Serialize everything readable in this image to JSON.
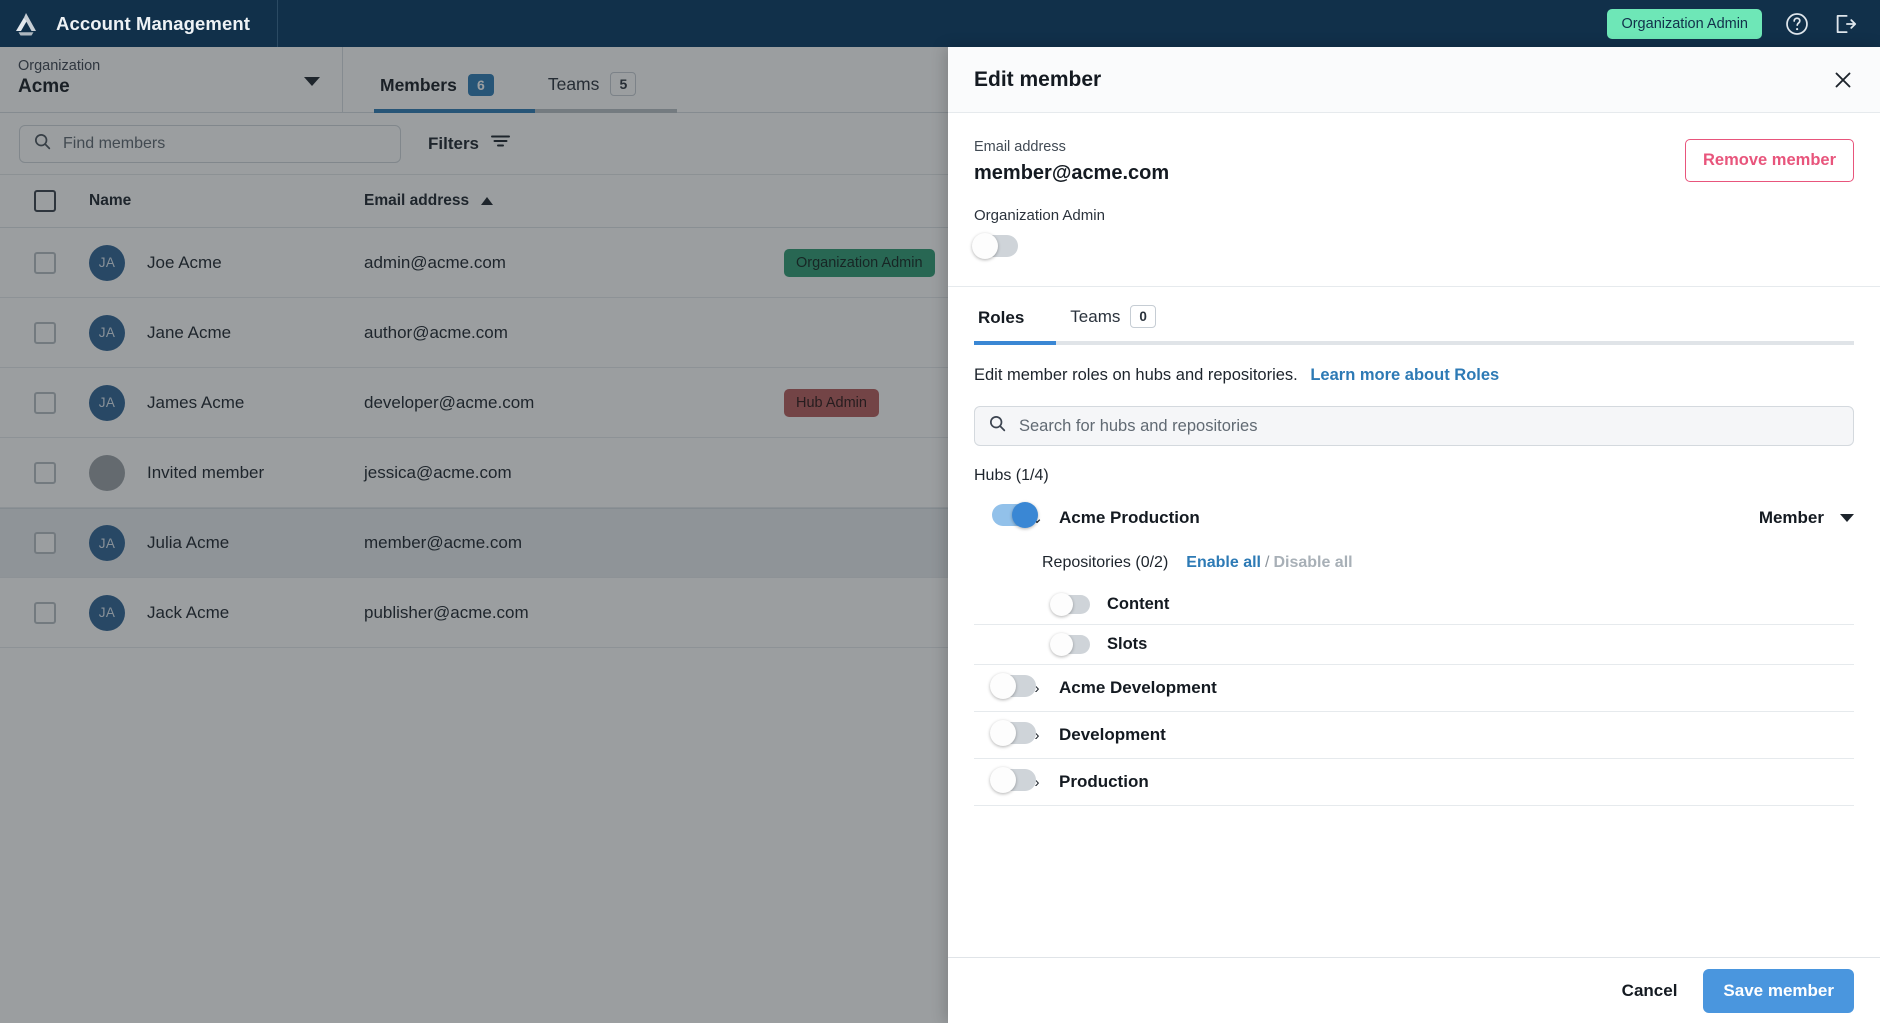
{
  "topbar": {
    "logo_icon": "drive-triangle-logo",
    "app_title": "Account Management",
    "role_badge": "Organization Admin",
    "help_icon": "help-circle-icon",
    "logout_icon": "logout-icon",
    "badge_color": "#6ee7b7",
    "bg_color": "#11304a"
  },
  "org_picker": {
    "label": "Organization",
    "value": "Acme",
    "caret_icon": "chevron-down-icon"
  },
  "tabs": [
    {
      "label": "Members",
      "count": "6",
      "active": true
    },
    {
      "label": "Teams",
      "count": "5",
      "active": false
    }
  ],
  "toolbar": {
    "search_placeholder": "Find members",
    "search_value": "",
    "search_icon": "search-icon",
    "filters_label": "Filters",
    "filters_icon": "filter-icon"
  },
  "table": {
    "columns": {
      "name": "Name",
      "email": "Email address",
      "sort_icon": "sort-asc-caret"
    },
    "rows": [
      {
        "initials": "JA",
        "name": "Joe Acme",
        "email": "admin@acme.com",
        "badge": "Organization Admin",
        "badge_type": "green",
        "selected": false,
        "has_avatar": true
      },
      {
        "initials": "JA",
        "name": "Jane Acme",
        "email": "author@acme.com",
        "badge": "",
        "badge_type": "",
        "selected": false,
        "has_avatar": true
      },
      {
        "initials": "JA",
        "name": "James Acme",
        "email": "developer@acme.com",
        "badge": "Hub Admin",
        "badge_type": "red",
        "selected": false,
        "has_avatar": true
      },
      {
        "initials": "",
        "name": "Invited member",
        "email": "jessica@acme.com",
        "badge": "",
        "badge_type": "",
        "selected": false,
        "has_avatar": false
      },
      {
        "initials": "JA",
        "name": "Julia Acme",
        "email": "member@acme.com",
        "badge": "",
        "badge_type": "",
        "selected": true,
        "has_avatar": true
      },
      {
        "initials": "JA",
        "name": "Jack Acme",
        "email": "publisher@acme.com",
        "badge": "",
        "badge_type": "",
        "selected": false,
        "has_avatar": true
      }
    ]
  },
  "drawer": {
    "title": "Edit member",
    "close_icon": "close-icon",
    "email_label": "Email address",
    "email_value": "member@acme.com",
    "remove_label": "Remove member",
    "org_admin_label": "Organization Admin",
    "org_admin_on": false,
    "tabs": [
      {
        "label": "Roles",
        "count": "",
        "active": true
      },
      {
        "label": "Teams",
        "count": "0",
        "active": false
      }
    ],
    "roles_description": "Edit member roles on hubs and repositories.",
    "roles_link": "Learn more about Roles",
    "hub_search_placeholder": "Search for hubs and repositories",
    "hub_search_value": "",
    "hub_search_icon": "search-icon",
    "hubs_count_label": "Hubs (1/4)",
    "hubs": [
      {
        "name": "Acme Production",
        "enabled": true,
        "expanded": true,
        "chevron_icon": "chevron-down-icon",
        "role": "Member",
        "role_caret_icon": "chevron-down-icon",
        "repos_count_label": "Repositories (0/2)",
        "enable_all_label": "Enable all",
        "disable_all_label": "Disable all",
        "repositories": [
          {
            "name": "Content",
            "enabled": false
          },
          {
            "name": "Slots",
            "enabled": false
          }
        ]
      },
      {
        "name": "Acme Development",
        "enabled": false,
        "expanded": false,
        "chevron_icon": "chevron-right-icon",
        "role": "",
        "repositories": []
      },
      {
        "name": "Development",
        "enabled": false,
        "expanded": false,
        "chevron_icon": "chevron-right-icon",
        "role": "",
        "repositories": []
      },
      {
        "name": "Production",
        "enabled": false,
        "expanded": false,
        "chevron_icon": "chevron-right-icon",
        "role": "",
        "repositories": []
      }
    ],
    "cancel_label": "Cancel",
    "save_label": "Save member",
    "save_color": "#4a96de",
    "remove_color": "#e8557c"
  }
}
